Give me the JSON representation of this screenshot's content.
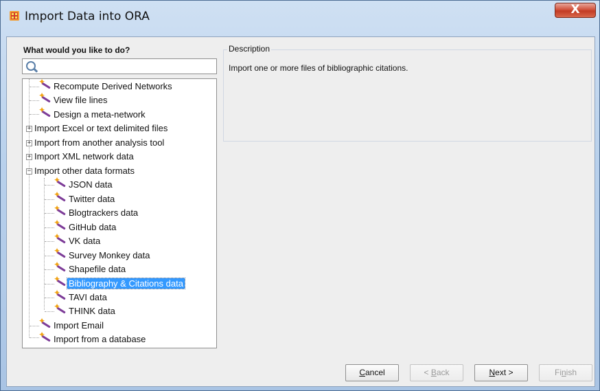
{
  "window": {
    "title": "Import Data into ORA",
    "close_glyph": "X"
  },
  "left": {
    "heading": "What would you like to do?",
    "search": {
      "value": "",
      "placeholder": ""
    }
  },
  "tree": {
    "items": [
      {
        "label": "Recompute Derived Networks"
      },
      {
        "label": "View file lines"
      },
      {
        "label": "Design a meta-network"
      },
      {
        "label": "Import Excel or text delimited files",
        "expander": "+"
      },
      {
        "label": "Import from another analysis tool",
        "expander": "+"
      },
      {
        "label": "Import XML network data",
        "expander": "+"
      },
      {
        "label": "Import other data formats",
        "expander": "−"
      },
      {
        "label": "JSON data"
      },
      {
        "label": "Twitter data"
      },
      {
        "label": "Blogtrackers data"
      },
      {
        "label": "GitHub data"
      },
      {
        "label": "VK data"
      },
      {
        "label": "Survey Monkey data"
      },
      {
        "label": "Shapefile data"
      },
      {
        "label": "Bibliography & Citations data",
        "selected": true
      },
      {
        "label": "TAVI data"
      },
      {
        "label": "THINK data"
      },
      {
        "label": "Import Email"
      },
      {
        "label": "Import from a database"
      }
    ]
  },
  "description": {
    "legend": "Description",
    "text": "Import one or more files of bibliographic citations."
  },
  "buttons": {
    "cancel": {
      "pre": "",
      "key": "C",
      "post": "ancel"
    },
    "back": {
      "pre": "< ",
      "key": "B",
      "post": "ack"
    },
    "next": {
      "pre": "",
      "key": "N",
      "post": "ext >"
    },
    "finish": {
      "pre": "Fi",
      "key": "n",
      "post": "ish"
    }
  },
  "colors": {
    "selection": "#3399ff",
    "title_bar": "#b9d1ec",
    "close": "#c23b24"
  },
  "icons": {
    "app": "ora-app-icon",
    "search": "search-icon",
    "item": "magic-wand-icon"
  }
}
